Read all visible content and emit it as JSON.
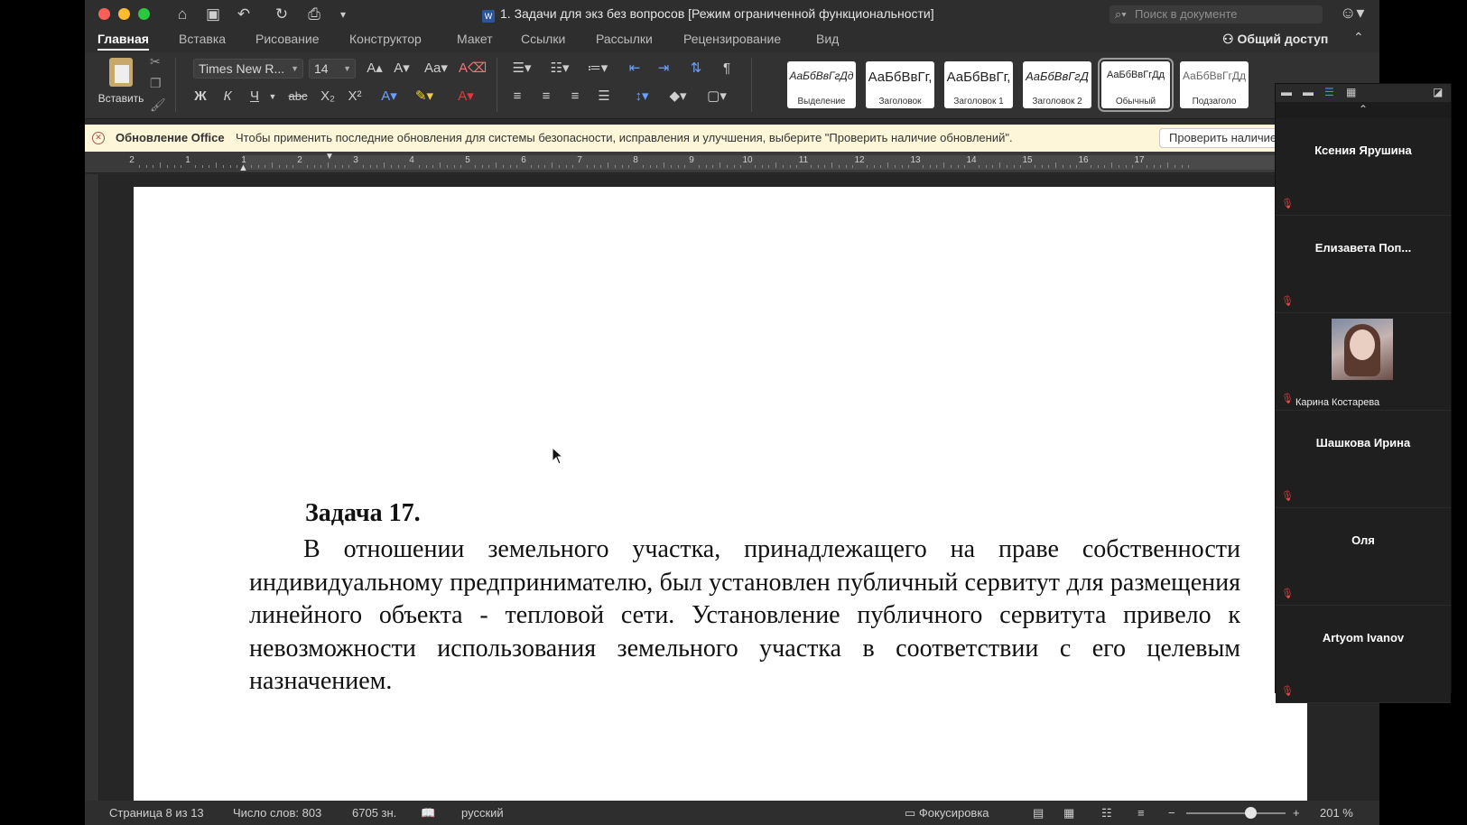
{
  "window": {
    "title": "1. Задачи для экз без вопросов [Режим ограниченной функциональности]",
    "search_placeholder": "Поиск в документе"
  },
  "tabs": [
    "Главная",
    "Вставка",
    "Рисование",
    "Конструктор",
    "Макет",
    "Ссылки",
    "Рассылки",
    "Рецензирование",
    "Вид"
  ],
  "share_label": "Общий доступ",
  "ribbon": {
    "paste_label": "Вставить",
    "font_name": "Times New R...",
    "font_size": "14",
    "bold": "Ж",
    "italic": "К",
    "underline": "Ч",
    "strike": "abc",
    "subscript": "X₂",
    "superscript": "X²",
    "styles": [
      {
        "sample": "АаБбВвГгДд",
        "name": "Выделение"
      },
      {
        "sample": "АаБбВвГг,",
        "name": "Заголовок"
      },
      {
        "sample": "АаБбВвГг,",
        "name": "Заголовок 1"
      },
      {
        "sample": "АаБбВвГгД",
        "name": "Заголовок 2"
      },
      {
        "sample": "АаБбВвГгДд",
        "name": "Обычный"
      },
      {
        "sample": "АаБбВвГгДд",
        "name": "Подзаголо"
      }
    ],
    "selected_style": "Обычный"
  },
  "notification": {
    "title": "Обновление Office",
    "message": "Чтобы применить последние обновления для системы безопасности, исправления и улучшения, выберите \"Проверить наличие обновлений\".",
    "button": "Проверить наличие обновлений"
  },
  "ruler_numbers": [
    "2",
    "1",
    "1",
    "2",
    "3",
    "4",
    "5",
    "6",
    "7",
    "8",
    "9",
    "10",
    "11",
    "12",
    "13",
    "14",
    "15",
    "16",
    "17"
  ],
  "document": {
    "heading": "Задача 17.",
    "paragraph": "В отношении земельного участка, принадлежащего на праве собственности индивидуальному предпринимателю, был установлен публичный сервитут для размещения линейного объекта - тепловой сети. Установление публичного сервитута привело к невозможности использования земельного участка в соответствии с его целевым назначением."
  },
  "statusbar": {
    "page": "Страница 8 из 13",
    "words": "Число слов: 803",
    "chars": "6705 зн.",
    "language": "русский",
    "focus": "Фокусировка",
    "zoom": "201 %",
    "zoom_minus": "−",
    "zoom_plus": "+"
  },
  "participants": [
    {
      "name": "Ксения Ярушина",
      "video": false
    },
    {
      "name": "Елизавета  Поп...",
      "video": false
    },
    {
      "name": "Карина Костарева",
      "video": true
    },
    {
      "name": "Шашкова Ирина",
      "video": false
    },
    {
      "name": "Оля",
      "video": false
    },
    {
      "name": "Artyom Ivanov",
      "video": false
    }
  ],
  "colors": {
    "notice_bg": "#fdf6d8",
    "muted_mic": "#e04848",
    "word_blue": "#2b579a"
  }
}
